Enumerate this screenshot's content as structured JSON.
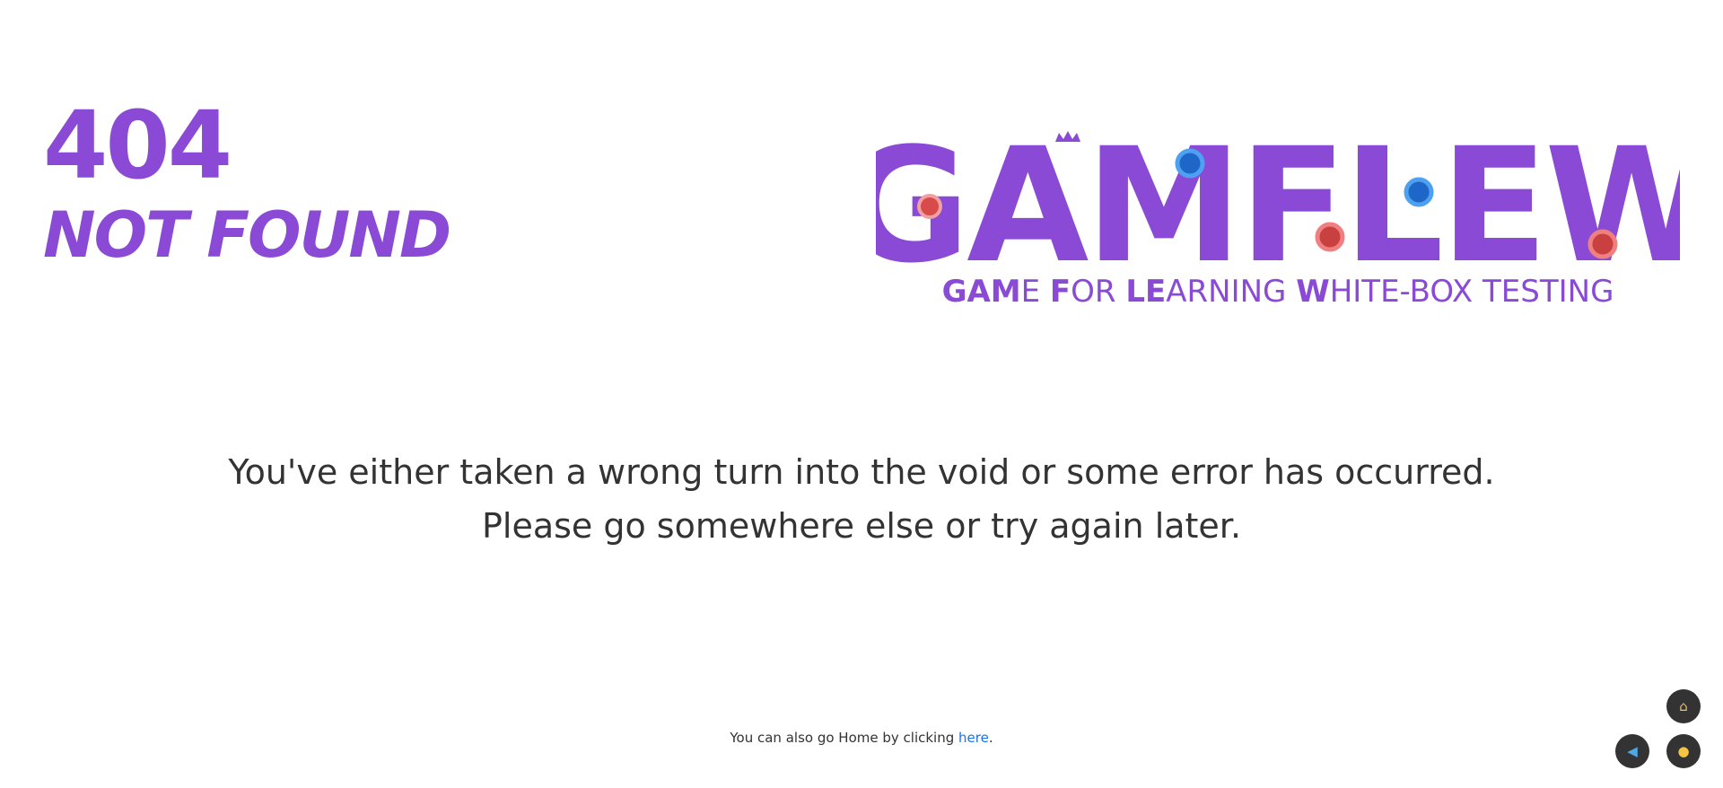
{
  "error": {
    "code": "404",
    "title": "NOT FOUND"
  },
  "logo": {
    "wordmark": "GAMFLEW",
    "tagline_parts": [
      {
        "text": "GAM",
        "bold": true
      },
      {
        "text": "E ",
        "bold": false
      },
      {
        "text": "F",
        "bold": true
      },
      {
        "text": "OR ",
        "bold": false
      },
      {
        "text": "LE",
        "bold": true
      },
      {
        "text": "ARNING ",
        "bold": false
      },
      {
        "text": "W",
        "bold": true
      },
      {
        "text": "HITE-BOX TESTING",
        "bold": false
      }
    ]
  },
  "message": {
    "line1": "You've either taken a wrong turn into the void or some error has occurred.",
    "line2": "Please go somewhere else or try again later."
  },
  "footer": {
    "prefix": "You can also go Home by clicking ",
    "link_text": "here",
    "suffix": "."
  },
  "fab_buttons": {
    "home_icon": "home-icon",
    "back_icon": "back-icon",
    "hint_icon": "lightbulb-icon"
  },
  "colors": {
    "brand_purple": "#8a4ad6",
    "dot_blue": "#1e7ee0",
    "dot_red": "#e04b4b",
    "text_dark": "#333333",
    "link_blue": "#1a73e8",
    "fab_bg": "#333333"
  }
}
